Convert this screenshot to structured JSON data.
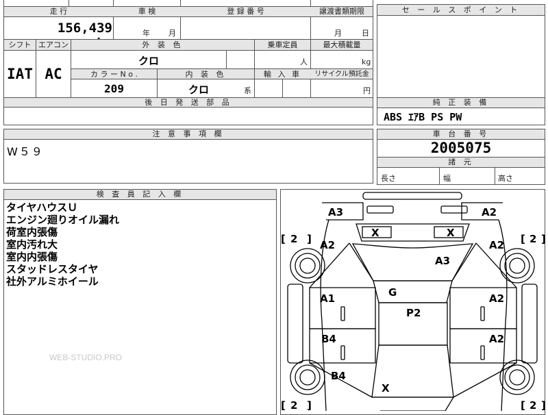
{
  "top": {
    "mileage_label": "走 行",
    "mileage_value": "156,439 km",
    "inspection_label": "車 検",
    "inspection_year_unit": "年",
    "inspection_month_unit": "月",
    "registration_label": "登 録 番 号",
    "transfer_label": "譲渡書類期限",
    "transfer_month_unit": "月",
    "transfer_day_unit": "日"
  },
  "row2": {
    "shift_label": "シフト",
    "shift_value": "IAT",
    "ac_label": "エアコン",
    "ac_value": "AC",
    "exterior_label": "外 装 色",
    "exterior_value": "クロ",
    "capacity_label": "乗車定員",
    "capacity_unit": "人",
    "load_label": "最大積載量",
    "load_unit": "kg",
    "color_no_label": "カ ラ ー N o .",
    "color_no_value": "209",
    "interior_label": "内 装 色",
    "interior_value": "クロ",
    "interior_suffix": "系",
    "import_label": "輸 入 車",
    "recycle_label": "リサイクル預託金",
    "recycle_unit": "円",
    "later_parts_label": "後 日 発 送 部 品"
  },
  "sales": {
    "label": "セ ー ル ス ポ イ ン ト"
  },
  "equipment": {
    "label": "純 正 装 備",
    "value": "ABS ｴｱB PS PW"
  },
  "notes": {
    "label": "注 意 事 項 欄",
    "value": "W５９"
  },
  "chassis": {
    "label": "車 台 番 号",
    "value": "2005075",
    "spec_label": "諸 元",
    "length_label": "長さ",
    "width_label": "幅",
    "height_label": "高さ"
  },
  "inspector": {
    "label": "検 査 員 記 入 欄",
    "remarks": [
      "タイヤハウスＵ",
      "エンジン廻りオイル漏れ",
      "荷室内張傷",
      "室内汚れ大",
      "室内内張傷",
      "スタッドレスタイヤ",
      "社外アルミホイール"
    ]
  },
  "diagram": {
    "marks": {
      "front_left_corner": "A3",
      "front_right_corner": "A2",
      "left_fender": "A2",
      "right_fender": "A2",
      "windshield_left": "X",
      "windshield_right": "X",
      "hood": "A3",
      "roof_front": "G",
      "roof": "P2",
      "left_front_door": "A1",
      "right_front_door": "A2",
      "left_rear_door": "B4",
      "right_rear_door": "A2",
      "left_quarter": "B4",
      "rear_glass": "X"
    },
    "tire_left_front": "2",
    "tire_right_front": "2",
    "tire_left_rear": "2",
    "tire_right_rear": "2"
  },
  "watermark": "WEB-STUDIO.PRO"
}
